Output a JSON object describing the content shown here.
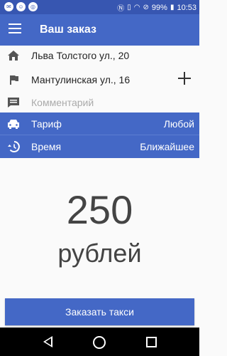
{
  "status_bar": {
    "battery": "99%",
    "time": "10:53",
    "icons": [
      "sms-icon",
      "face-icon",
      "globe-icon",
      "nfc-icon",
      "vibrate-icon",
      "wifi-icon",
      "no-sim-icon",
      "battery-icon"
    ]
  },
  "app_bar": {
    "title": "Ваш заказ"
  },
  "route": {
    "from": "Льва Толстого ул., 20",
    "to": "Мантулинская ул., 16",
    "comment_placeholder": "Комментарий"
  },
  "tariff": {
    "label": "Тариф",
    "value": "Любой"
  },
  "time": {
    "label": "Время",
    "value": "Ближайшее"
  },
  "price": {
    "amount": "250",
    "currency": "рублей"
  },
  "order_button": {
    "label": "Заказать такси"
  },
  "colors": {
    "primary": "#4468c6",
    "status": "#3756b1"
  }
}
